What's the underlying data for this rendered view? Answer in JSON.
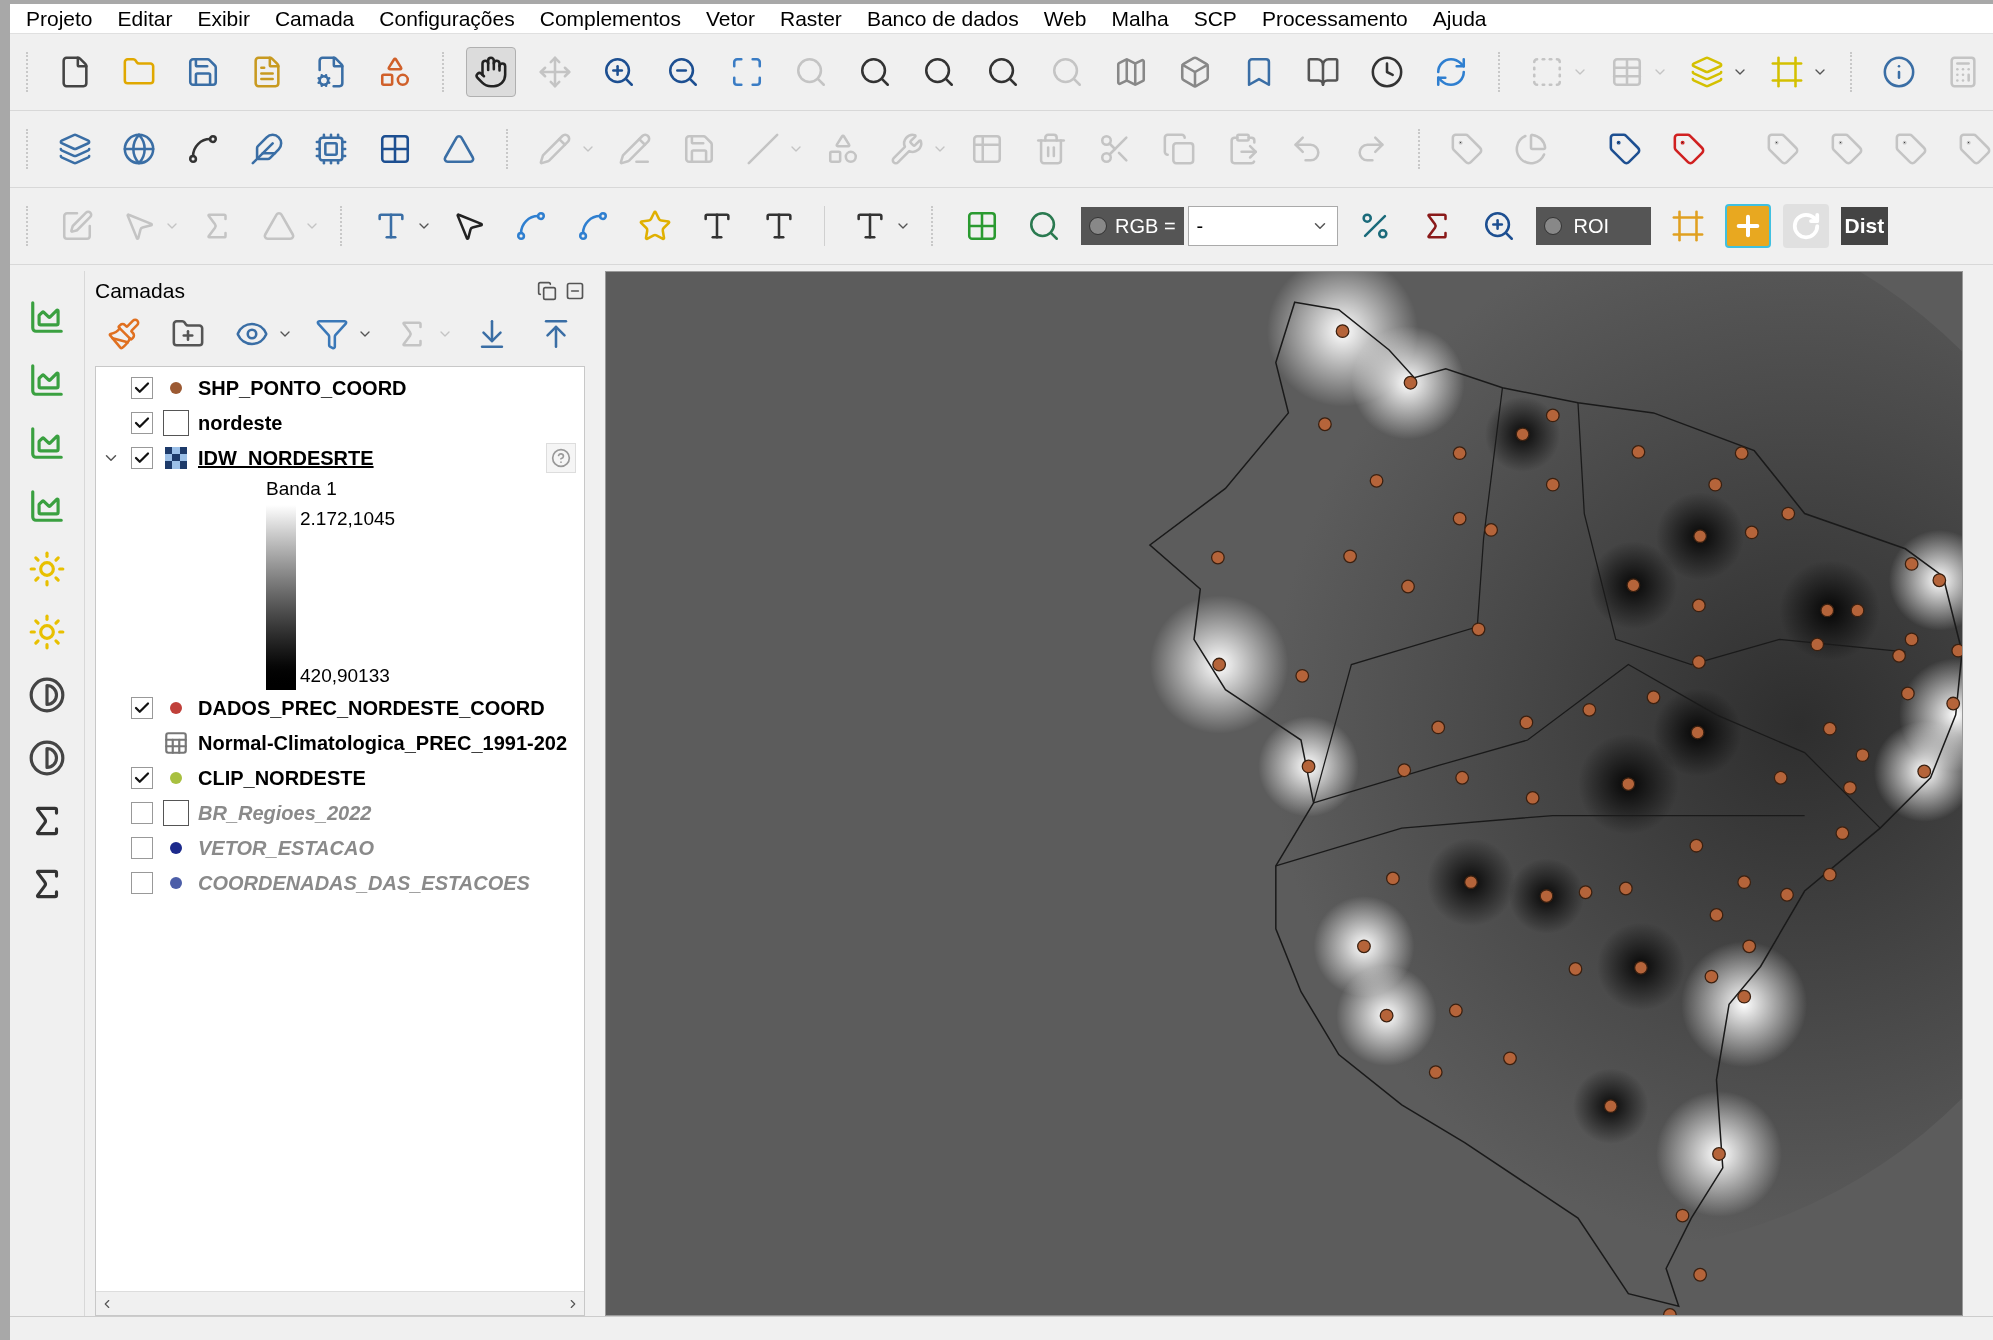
{
  "menu": [
    "Projeto",
    "Editar",
    "Exibir",
    "Camada",
    "Configurações",
    "Complementos",
    "Vetor",
    "Raster",
    "Banco de dados",
    "Web",
    "Malha",
    "SCP",
    "Processamento",
    "Ajuda"
  ],
  "scp_toolbar": {
    "rgb_label": "RGB =",
    "rgb_value": "-",
    "roi_label": "ROI",
    "dist_label": "Dist"
  },
  "layers_panel": {
    "title": "Camadas",
    "layers": [
      {
        "name": "SHP_PONTO_COORD",
        "kind": "point",
        "checked": true,
        "selected": false,
        "color": "#9c5a33"
      },
      {
        "name": "nordeste",
        "kind": "polygon",
        "checked": true,
        "selected": false
      },
      {
        "name": "IDW_NORDESRTE",
        "kind": "raster",
        "checked": true,
        "selected": true,
        "expanded": true,
        "legend": {
          "band": "Banda 1",
          "max": "2.172,1045",
          "min": "420,90133"
        }
      },
      {
        "name": "DADOS_PREC_NORDESTE_COORD",
        "kind": "point",
        "checked": true,
        "selected": false,
        "color": "#c0403a"
      },
      {
        "name": "Normal-Climatologica_PREC_1991-202",
        "kind": "table",
        "selected": false
      },
      {
        "name": "CLIP_NORDESTE",
        "kind": "point",
        "checked": true,
        "selected": false,
        "color": "#a8c040"
      },
      {
        "name": "BR_Regioes_2022",
        "kind": "polygon",
        "checked": false,
        "selected": false
      },
      {
        "name": "VETOR_ESTACAO",
        "kind": "point",
        "checked": false,
        "selected": false,
        "color": "#1c2a8c"
      },
      {
        "name": "COORDENADAS_DAS_ESTACOES",
        "kind": "point",
        "checked": false,
        "selected": false,
        "color": "#4c5ea8"
      }
    ]
  }
}
